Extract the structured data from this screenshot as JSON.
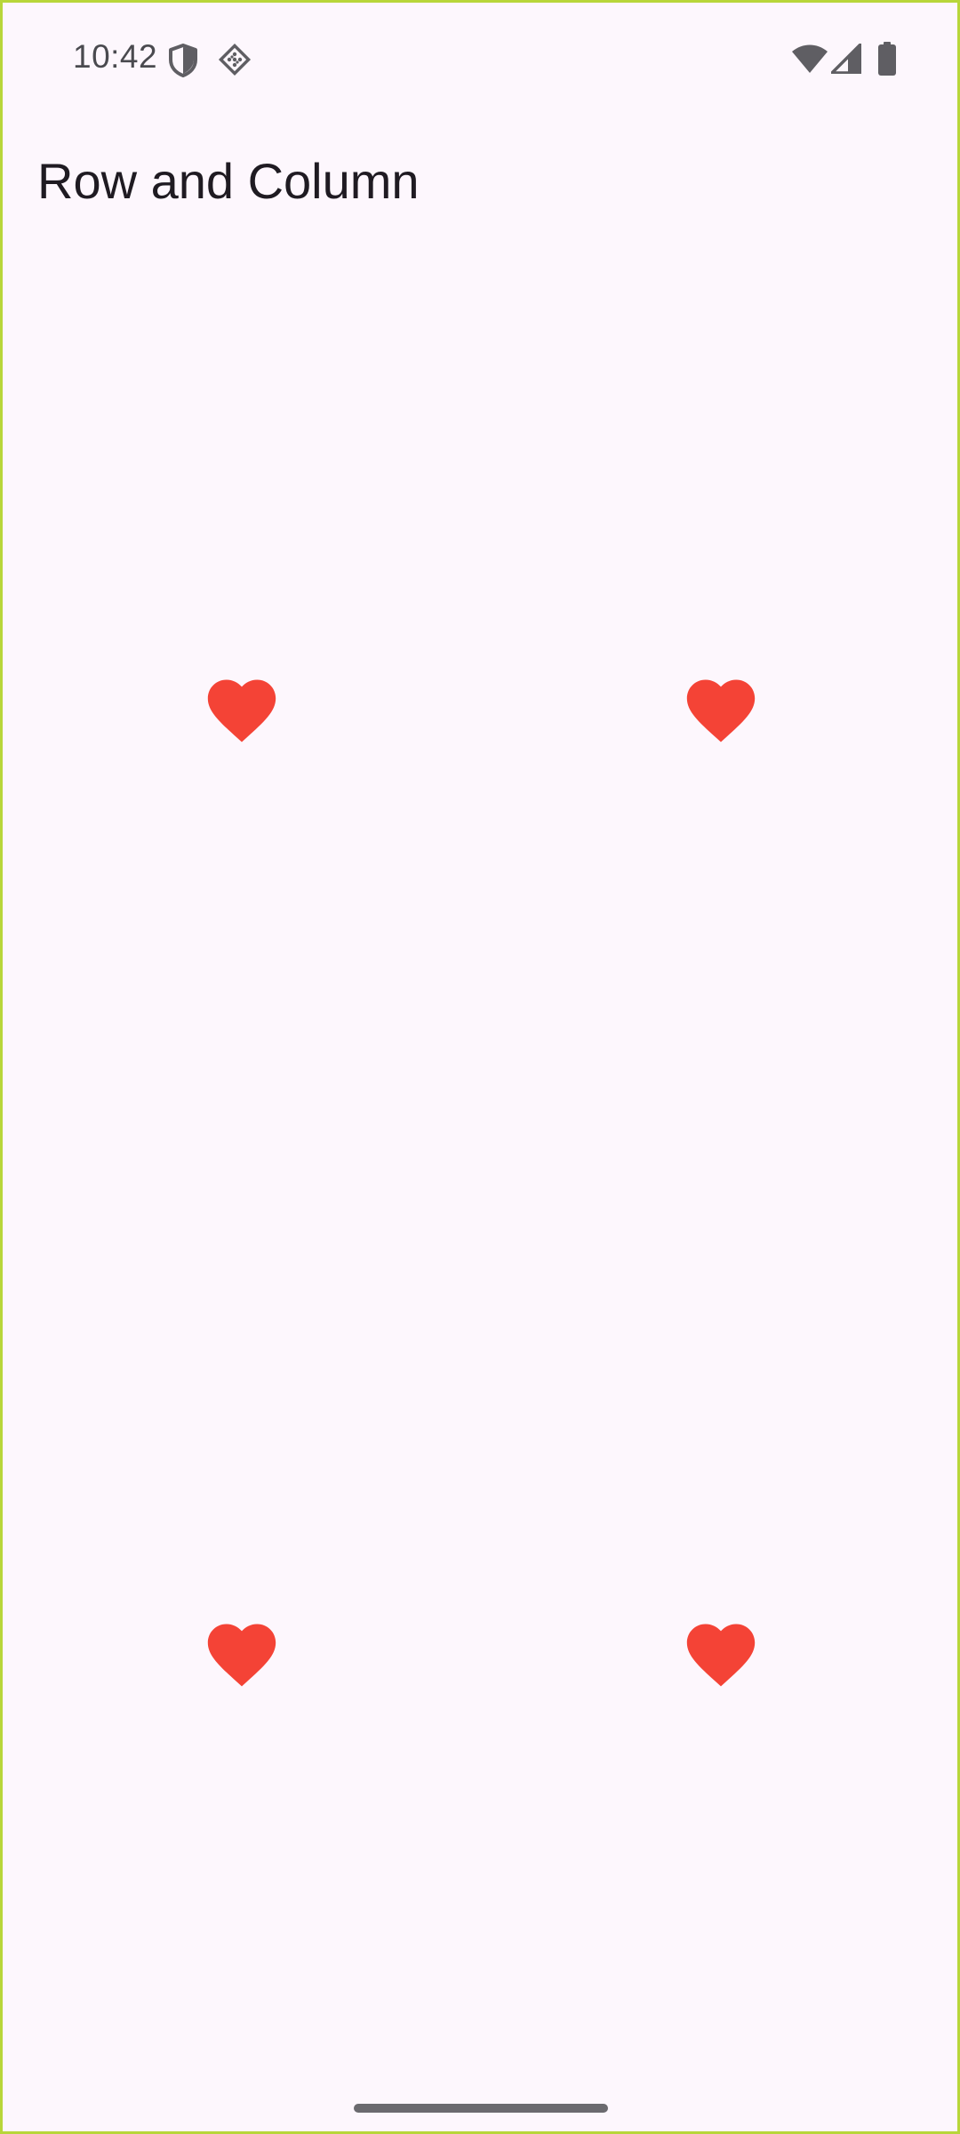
{
  "status_bar": {
    "time": "10:42",
    "icons": [
      "shield-icon",
      "data-saver-icon",
      "wifi-icon",
      "signal-icon",
      "battery-icon"
    ]
  },
  "app": {
    "title": "Row and Column"
  },
  "grid": {
    "rows": 2,
    "columns": 2,
    "icon": "heart-icon",
    "icon_color": "#f44336"
  },
  "colors": {
    "background": "#fdf7fd",
    "text": "#1f1b22",
    "status_icons": "#5f5e63"
  }
}
